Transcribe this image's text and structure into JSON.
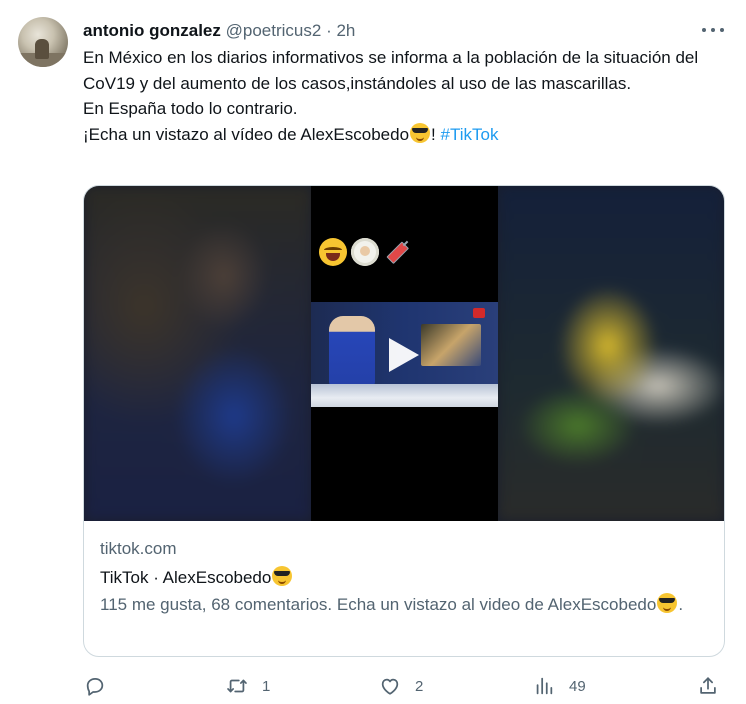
{
  "author": {
    "name": "antonio gonzalez",
    "handle": "@poetricus2",
    "separator": "·",
    "time": "2h"
  },
  "tweet": {
    "line1": "En México en los diarios informativos se informa a la población de la situación del CoV19 y del aumento de los casos,instándoles al uso de las mascarillas.",
    "line2": "En España todo lo contrario.",
    "line3_prefix": "¡Echa un vistazo al vídeo de AlexEscobedo",
    "line3_suffix": "! ",
    "hashtag": "#TikTok"
  },
  "card": {
    "domain": "tiktok.com",
    "title": "TikTok · AlexEscobedo",
    "description_prefix": "115 me gusta, 68 comentarios. Echa un vistazo al video de AlexEscobedo",
    "description_suffix": "."
  },
  "actions": {
    "reply_count": "",
    "retweet_count": "1",
    "like_count": "2",
    "views_count": "49"
  },
  "icons": {
    "more": "more-horizontal-icon",
    "reply": "reply-icon",
    "retweet": "retweet-icon",
    "like": "heart-icon",
    "views": "views-bar-chart-icon",
    "share": "share-icon",
    "play": "play-icon"
  },
  "colors": {
    "accent": "#1d9bf0",
    "text": "#0f1419",
    "muted": "#536471",
    "border": "#cfd9de"
  }
}
